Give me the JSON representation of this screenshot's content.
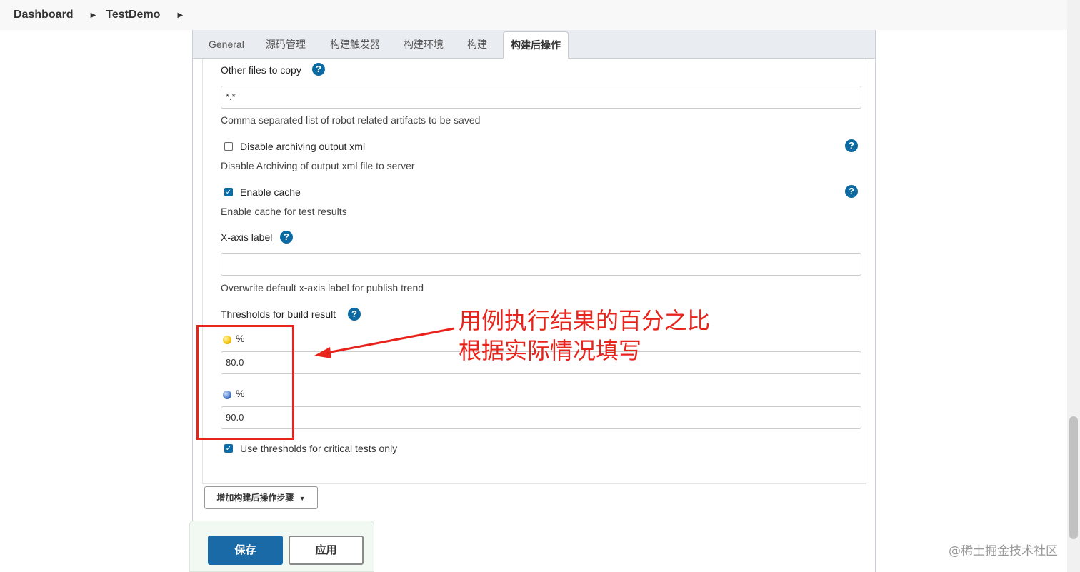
{
  "breadcrumb": {
    "items": [
      "Dashboard",
      "TestDemo"
    ]
  },
  "tabs": [
    {
      "label": "General"
    },
    {
      "label": "源码管理"
    },
    {
      "label": "构建触发器"
    },
    {
      "label": "构建环境"
    },
    {
      "label": "构建"
    },
    {
      "label": "构建后操作",
      "active": true
    }
  ],
  "form": {
    "other_files": {
      "label": "Other files to copy",
      "value": "*.*",
      "description": "Comma separated list of robot related artifacts to be saved"
    },
    "disable_archiving": {
      "label": "Disable archiving output xml",
      "checked": false,
      "description": "Disable Archiving of output xml file to server"
    },
    "enable_cache": {
      "label": "Enable cache",
      "checked": true,
      "description": "Enable cache for test results"
    },
    "x_axis": {
      "label": "X-axis label",
      "value": "",
      "description": "Overwrite default x-axis label for publish trend"
    },
    "thresholds": {
      "label": "Thresholds for build result",
      "unstable": {
        "unit": "%",
        "value": "80.0"
      },
      "pass": {
        "unit": "%",
        "value": "90.0"
      }
    },
    "critical_only": {
      "label": "Use thresholds for critical tests only",
      "checked": true
    }
  },
  "help_glyph": "?",
  "add_step_label": "增加构建后操作步骤",
  "buttons": {
    "save": "保存",
    "apply": "应用"
  },
  "annotation": {
    "line1": "用例执行结果的百分之比",
    "line2": "根据实际情况填写",
    "color": "#e8231c"
  },
  "watermark": "@稀土掘金技术社区",
  "colors": {
    "accent": "#0b6aa2",
    "save_button": "#1a6aa8"
  }
}
